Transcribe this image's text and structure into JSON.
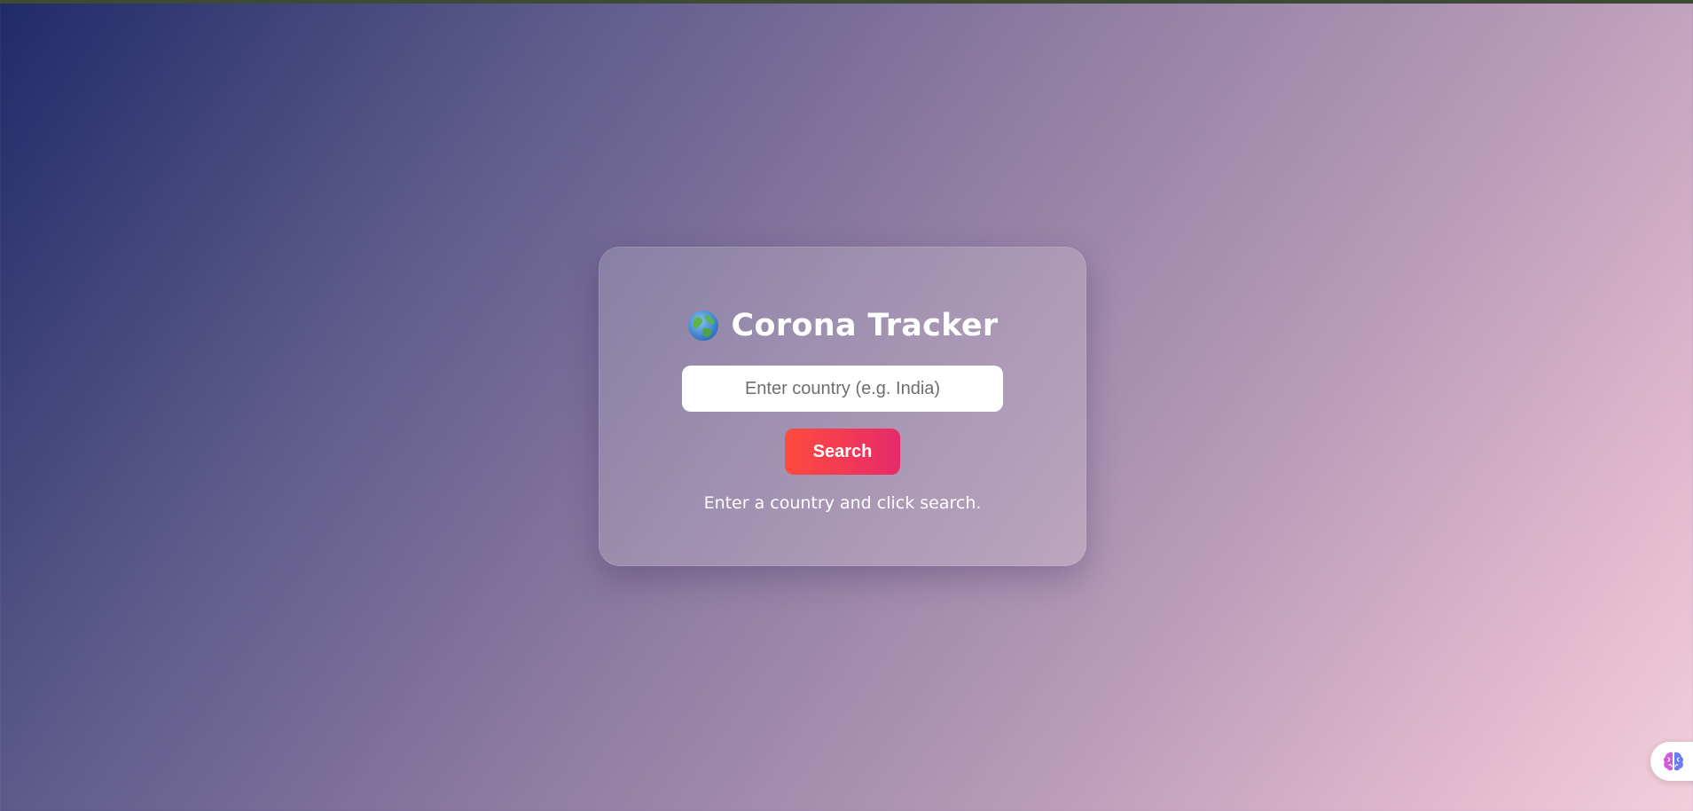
{
  "app": {
    "title": "Corona Tracker",
    "title_icon": "globe-icon"
  },
  "search": {
    "placeholder": "Enter country (e.g. India)",
    "value": "",
    "button_label": "Search"
  },
  "status": {
    "message": "Enter a country and click search."
  },
  "widget": {
    "icon": "brain-icon"
  },
  "colors": {
    "button_start": "#ff4b3e",
    "button_end": "#e62a6a",
    "background_start": "#1f2b68",
    "background_end": "#f3cfdc"
  }
}
